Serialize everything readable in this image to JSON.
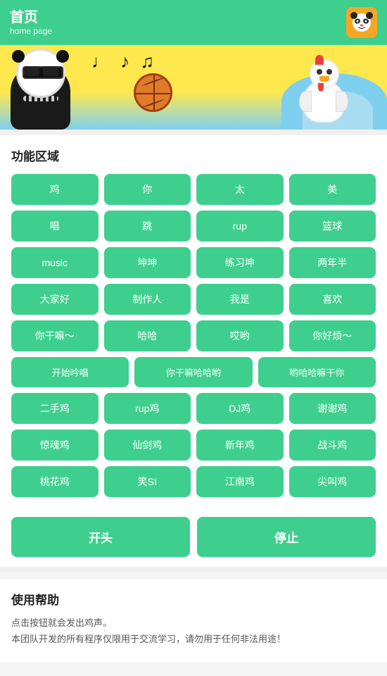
{
  "header": {
    "title": "首页",
    "subtitle": "home page",
    "avatar_label": "panda-avatar"
  },
  "banner": {
    "alt": "banner-image"
  },
  "function_area": {
    "title": "功能区域",
    "rows": [
      [
        "鸡",
        "你",
        "太",
        "美"
      ],
      [
        "唱",
        "跳",
        "rup",
        "篮球"
      ],
      [
        "music",
        "坤坤",
        "练习坤",
        "两年半"
      ],
      [
        "大家好",
        "制作人",
        "我是",
        "喜欢"
      ],
      [
        "你干嘛～",
        "哈哈",
        "哎哟",
        "你好烦～"
      ],
      [
        "开始吟唱",
        "你干嘛哈哈哟",
        "哟哈哈嘛干你"
      ],
      [
        "二手鸡",
        "rup鸡",
        "DJ鸡",
        "谢谢鸡"
      ],
      [
        "惊魂鸡",
        "仙剑鸡",
        "新年鸡",
        "战斗鸡"
      ],
      [
        "桃花鸡",
        "笑SI",
        "江南鸡",
        "尖叫鸡"
      ]
    ]
  },
  "actions": {
    "start": "开头",
    "stop": "停止"
  },
  "help": {
    "title": "使用帮助",
    "line1": "点击按钮就会发出鸡声。",
    "line2": "本团队开发的所有程序仅限用于交流学习，请勿用于任何非法用途！"
  }
}
